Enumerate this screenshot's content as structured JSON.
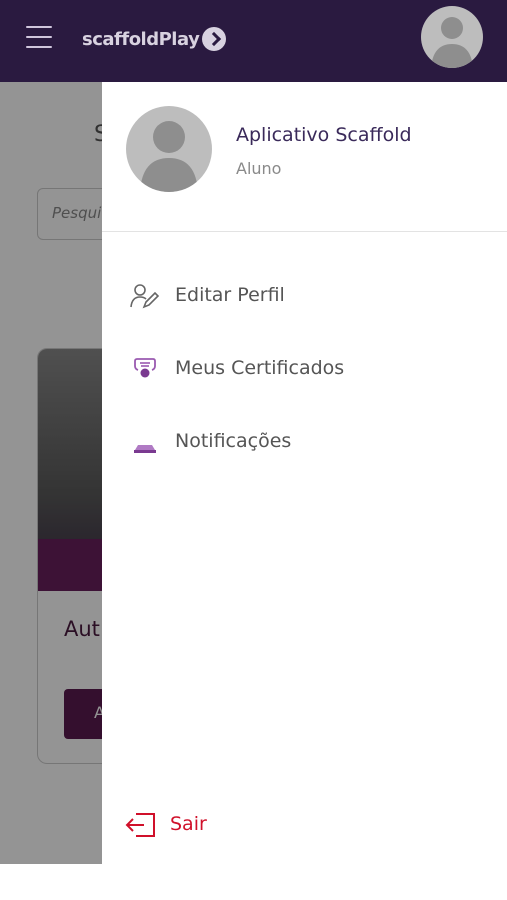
{
  "topbar": {
    "logo_text": "scaffoldPlay",
    "menu_icon": "hamburger-menu-icon",
    "avatar_icon": "user-avatar-icon"
  },
  "background": {
    "page_title_partial": "S",
    "search_placeholder_partial": "Pesqui",
    "card_title_partial": "Aut",
    "card_button_partial": "A"
  },
  "drawer": {
    "user": {
      "name": "Aplicativo Scaffold",
      "role": "Aluno"
    },
    "menu": [
      {
        "label": "Editar Perfil",
        "icon": "edit-profile-icon"
      },
      {
        "label": "Meus Certificados",
        "icon": "certificate-icon"
      },
      {
        "label": "Notificações",
        "icon": "notification-icon"
      }
    ],
    "logout_label": "Sair"
  },
  "colors": {
    "topbar": "#2a1a40",
    "accent": "#9a5ab0",
    "logout": "#d0102a"
  }
}
